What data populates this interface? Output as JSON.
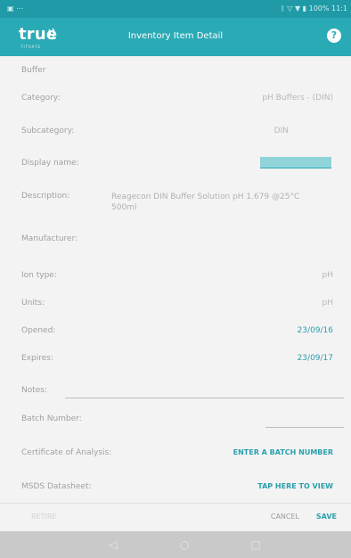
{
  "statusbar": {
    "left": "▣ ⋯",
    "right": "ᛒ ▽ ▼ ▮ 100% 11:1"
  },
  "appbar": {
    "logo_text": "true",
    "logo_sub": "TITRATE",
    "title": "Inventory Item Detail",
    "help": "?"
  },
  "section": "Buffer",
  "fields": {
    "category": {
      "label": "Category:",
      "value": "pH Buffers - (DIN)"
    },
    "subcategory": {
      "label": "Subcategory:",
      "value": "DIN"
    },
    "display_name": {
      "label": "Display name:",
      "value": ""
    },
    "description": {
      "label": "Description:",
      "value": "Reagecon DIN Buffer Solution pH 1.679 @25°C 500ml"
    },
    "manufacturer": {
      "label": "Manufacturer:"
    },
    "ion_type": {
      "label": "Ion type:",
      "value": "pH"
    },
    "units": {
      "label": "Units:",
      "value": "pH"
    },
    "opened": {
      "label": "Opened:",
      "value": "23/09/16"
    },
    "expires": {
      "label": "Expires:",
      "value": "23/09/17"
    },
    "notes": {
      "label": "Notes:"
    },
    "batch_number": {
      "label": "Batch Number:"
    },
    "certificate": {
      "label": "Certificate of Analysis:",
      "value": "ENTER A BATCH NUMBER"
    },
    "msds": {
      "label": "MSDS Datasheet:",
      "value": "TAP HERE TO VIEW"
    }
  },
  "actions": {
    "retire": "RETIRE",
    "cancel": "CANCEL",
    "save": "SAVE"
  },
  "nav": {
    "back": "◁",
    "home": "○",
    "recent": "□"
  }
}
